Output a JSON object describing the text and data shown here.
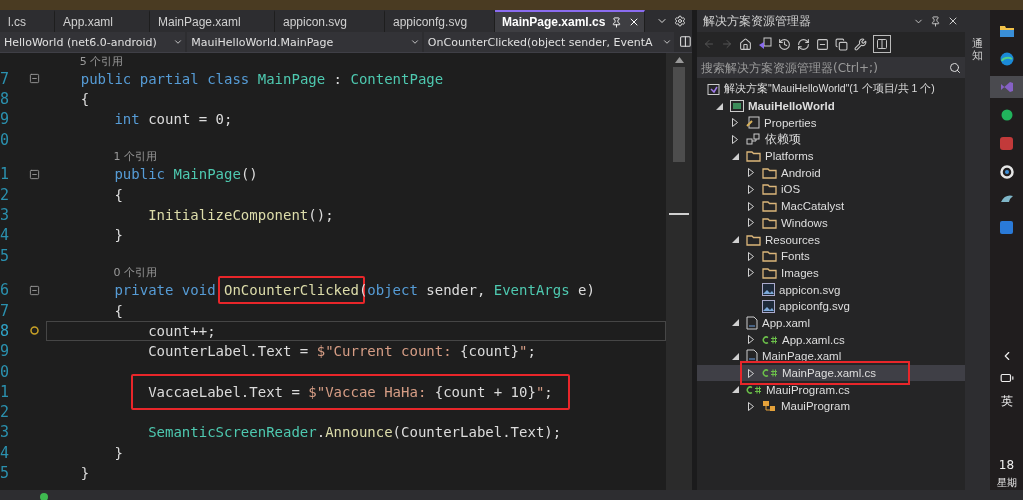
{
  "tabs": [
    {
      "label": "l.cs",
      "selected": false
    },
    {
      "label": "App.xaml",
      "selected": false
    },
    {
      "label": "MainPage.xaml",
      "selected": false
    },
    {
      "label": "appicon.svg",
      "selected": false
    },
    {
      "label": "appiconfg.svg",
      "selected": false
    },
    {
      "label": "MainPage.xaml.cs",
      "selected": true
    }
  ],
  "navigation": {
    "project": "HelloWorld (net6.0-android)",
    "type": "MauiHelloWorld.MainPage",
    "member": "OnCounterClicked(object sender, EventA"
  },
  "code_lines": [
    {
      "kind": "codelens",
      "text": "    5 个引用"
    },
    {
      "kind": "code",
      "number": "7",
      "fold": true,
      "tokens": [
        {
          "kind": "keyword",
          "text": "    public partial class "
        },
        {
          "kind": "type",
          "text": "MainPage"
        },
        {
          "kind": "plain",
          "text": " : "
        },
        {
          "kind": "type",
          "text": "ContentPage"
        }
      ]
    },
    {
      "kind": "code",
      "number": "8",
      "tokens": [
        {
          "kind": "plain",
          "text": "    {"
        }
      ]
    },
    {
      "kind": "code",
      "number": "9",
      "tokens": [
        {
          "kind": "keyword",
          "text": "        int"
        },
        {
          "kind": "plain",
          "text": " count = 0;"
        }
      ]
    },
    {
      "kind": "code",
      "number": "0"
    },
    {
      "kind": "codelens",
      "text": "        1 个引用"
    },
    {
      "kind": "code",
      "number": "1",
      "fold": true,
      "tokens": [
        {
          "kind": "keyword",
          "text": "        public "
        },
        {
          "kind": "type",
          "text": "MainPage"
        },
        {
          "kind": "plain",
          "text": "()"
        }
      ]
    },
    {
      "kind": "code",
      "number": "2",
      "tokens": [
        {
          "kind": "plain",
          "text": "        {"
        }
      ]
    },
    {
      "kind": "code",
      "number": "3",
      "tokens": [
        {
          "kind": "method",
          "text": "            InitializeComponent"
        },
        {
          "kind": "plain",
          "text": "();"
        }
      ]
    },
    {
      "kind": "code",
      "number": "4",
      "tokens": [
        {
          "kind": "plain",
          "text": "        }"
        }
      ]
    },
    {
      "kind": "code",
      "number": "5"
    },
    {
      "kind": "codelens",
      "text": "        0 个引用"
    },
    {
      "kind": "code",
      "number": "6",
      "fold": true,
      "tokens": [
        {
          "kind": "keyword",
          "text": "        private void "
        },
        {
          "kind": "method",
          "text": "OnCounterClicked",
          "boxed": true
        },
        {
          "kind": "plain",
          "text": "("
        },
        {
          "kind": "keyword",
          "text": "object"
        },
        {
          "kind": "plain",
          "text": " sender, "
        },
        {
          "kind": "type",
          "text": "EventArgs"
        },
        {
          "kind": "plain",
          "text": " e)"
        }
      ]
    },
    {
      "kind": "code",
      "number": "7",
      "tokens": [
        {
          "kind": "plain",
          "text": "        {"
        }
      ]
    },
    {
      "kind": "code",
      "number": "8",
      "current": true,
      "tokens": [
        {
          "kind": "plain",
          "text": "            count++;"
        }
      ]
    },
    {
      "kind": "code",
      "number": "9",
      "tokens": [
        {
          "kind": "plain",
          "text": "            CounterLabel.Text = "
        },
        {
          "kind": "string",
          "text": "$\"Current count: "
        },
        {
          "kind": "plain",
          "text": "{count}"
        },
        {
          "kind": "string",
          "text": "\""
        },
        {
          "kind": "plain",
          "text": ";"
        }
      ]
    },
    {
      "kind": "code",
      "number": "0"
    },
    {
      "kind": "code",
      "number": "1",
      "boxed": true,
      "tokens": [
        {
          "kind": "plain",
          "text": "            VaccaeLabel.Text = "
        },
        {
          "kind": "string",
          "text": "$\"Vaccae HaHa: "
        },
        {
          "kind": "plain",
          "text": "{count + 10}"
        },
        {
          "kind": "string",
          "text": "\""
        },
        {
          "kind": "plain",
          "text": ";"
        }
      ]
    },
    {
      "kind": "code",
      "number": "2"
    },
    {
      "kind": "code",
      "number": "3",
      "tokens": [
        {
          "kind": "type",
          "text": "            SemanticScreenReader"
        },
        {
          "kind": "plain",
          "text": "."
        },
        {
          "kind": "method",
          "text": "Announce"
        },
        {
          "kind": "plain",
          "text": "(CounterLabel.Text);"
        }
      ]
    },
    {
      "kind": "code",
      "number": "4",
      "tokens": [
        {
          "kind": "plain",
          "text": "        }"
        }
      ]
    },
    {
      "kind": "code",
      "number": "5",
      "tokens": [
        {
          "kind": "plain",
          "text": "    }"
        }
      ]
    }
  ],
  "solution_explorer": {
    "title": "解决方案资源管理器",
    "search": {
      "placeholder": "搜索解决方案资源管理器(Ctrl+;)"
    },
    "tree": [
      {
        "label": "解决方案\"MauiHelloWorld\"(1 个项目/共 1 个)",
        "kind": "solution",
        "selected": false,
        "children": [
          {
            "label": "MauiHelloWorld",
            "kind": "project",
            "expanded": true,
            "selected": false,
            "children": [
              {
                "label": "Properties",
                "kind": "properties",
                "expanded": false,
                "selected": false
              },
              {
                "label": "依赖项",
                "kind": "dependencies",
                "expanded": false,
                "selected": false
              },
              {
                "label": "Platforms",
                "kind": "folder",
                "expanded": true,
                "selected": false,
                "children": [
                  {
                    "label": "Android",
                    "kind": "folder",
                    "expanded": false,
                    "selected": false
                  },
                  {
                    "label": "iOS",
                    "kind": "folder",
                    "expanded": false,
                    "selected": false
                  },
                  {
                    "label": "MacCatalyst",
                    "kind": "folder",
                    "expanded": false,
                    "selected": false
                  },
                  {
                    "label": "Windows",
                    "kind": "folder",
                    "expanded": false,
                    "selected": false
                  }
                ]
              },
              {
                "label": "Resources",
                "kind": "folder",
                "expanded": true,
                "selected": false,
                "children": [
                  {
                    "label": "Fonts",
                    "kind": "folder",
                    "expanded": false,
                    "selected": false
                  },
                  {
                    "label": "Images",
                    "kind": "folder",
                    "expanded": false,
                    "selected": false
                  },
                  {
                    "label": "appicon.svg",
                    "kind": "image",
                    "selected": false
                  },
                  {
                    "label": "appiconfg.svg",
                    "kind": "image",
                    "selected": false
                  }
                ]
              },
              {
                "label": "App.xaml",
                "kind": "xaml",
                "expanded": true,
                "selected": false,
                "children": [
                  {
                    "label": "App.xaml.cs",
                    "kind": "csharp",
                    "expanded": false,
                    "selected": false
                  }
                ]
              },
              {
                "label": "MainPage.xaml",
                "kind": "xaml",
                "expanded": true,
                "selected": false,
                "children": [
                  {
                    "label": "MainPage.xaml.cs",
                    "kind": "csharp",
                    "expanded": false,
                    "selected": true,
                    "boxed": true
                  }
                ]
              },
              {
                "label": "MauiProgram.cs",
                "kind": "csharp",
                "expanded": true,
                "selected": false,
                "children": [
                  {
                    "label": "MauiProgram",
                    "kind": "class",
                    "expanded": false,
                    "selected": false
                  }
                ]
              }
            ]
          }
        ]
      }
    ]
  },
  "side_tab": "通知",
  "taskbar": {
    "apps": [
      {
        "kind": "folder",
        "selected": false
      },
      {
        "kind": "globe",
        "selected": false
      },
      {
        "kind": "studio",
        "selected": true
      },
      {
        "kind": "dot",
        "selected": false
      },
      {
        "kind": "app",
        "selected": false
      },
      {
        "kind": "circle",
        "selected": false
      },
      {
        "kind": "bird",
        "selected": false
      },
      {
        "kind": "window",
        "selected": false
      }
    ],
    "input_method": "英",
    "day": "18",
    "weekday": "星期"
  }
}
